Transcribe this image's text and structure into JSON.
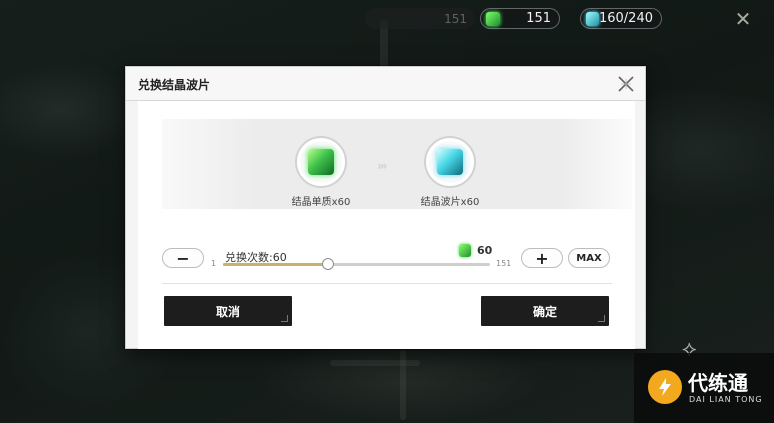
{
  "hud": {
    "faded_chip_value": "151",
    "crystal_core": {
      "icon": "green-crystal-icon",
      "value": "151"
    },
    "crystal_fragment": {
      "icon": "cyan-crystal-icon",
      "value": "160/240"
    },
    "close_icon": "close-icon"
  },
  "dialog": {
    "title": "兑换结晶波片",
    "source_item": {
      "icon": "green-crystal-cube-icon",
      "label": "结晶单质x60"
    },
    "target_item": {
      "icon": "cyan-crystal-cube-icon",
      "label": "结晶波片x60"
    },
    "exchange_label": "兑换次数:60",
    "cost": {
      "icon": "green-crystal-icon",
      "value": "60"
    },
    "slider": {
      "min_label": "1",
      "max_label": "151",
      "min": 1,
      "max": 151,
      "value": 60
    },
    "minus_label": "−",
    "plus_label": "+",
    "max_label": "MAX",
    "cancel_label": "取消",
    "confirm_label": "确定"
  },
  "watermark": {
    "name": "代练通",
    "sub": "DAI LIAN TONG"
  },
  "colors": {
    "slider_fill": "#c9b169",
    "button_dark": "#1d1d1d",
    "crystal_green": "#3fc24b",
    "crystal_cyan": "#46d5e6",
    "watermark_orange": "#f2a91d"
  }
}
